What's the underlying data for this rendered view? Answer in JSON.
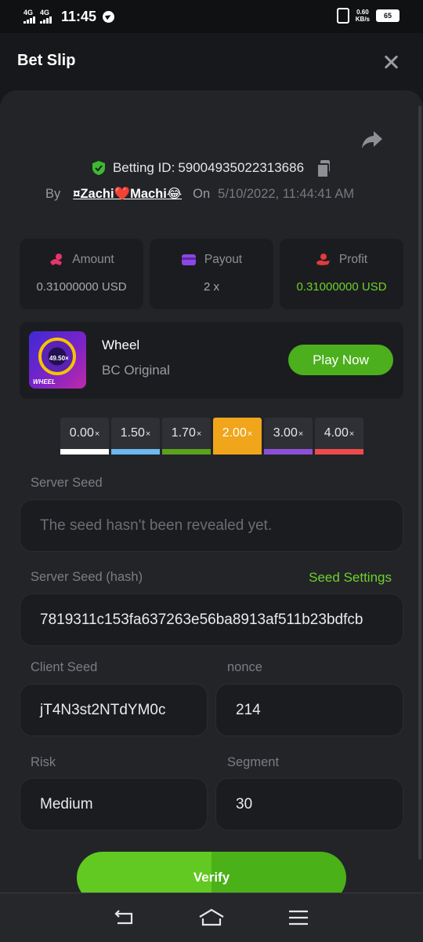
{
  "status_bar": {
    "network_1": "4G",
    "network_2": "4G",
    "time": "11:45",
    "speed": "0.60",
    "speed_unit": "KB/s",
    "battery": "65"
  },
  "header": {
    "title": "Bet Slip"
  },
  "bet_info": {
    "betting_id_label": "Betting ID:",
    "betting_id": "59004935022313686",
    "by_label": "By",
    "username": "¤Zachi❤️Machi😂",
    "on_label": "On",
    "date": "5/10/2022, 11:44:41 AM"
  },
  "stats": [
    {
      "label": "Amount",
      "value": "0.31000000 USD",
      "icon": "amount-icon"
    },
    {
      "label": "Payout",
      "value": "2 x",
      "icon": "payout-icon"
    },
    {
      "label": "Profit",
      "value": "0.31000000 USD",
      "icon": "profit-icon",
      "color": "#6ed12b"
    }
  ],
  "game": {
    "name": "Wheel",
    "subtitle": "BC Original",
    "play_label": "Play Now",
    "thumb_text": "49.50×",
    "thumb_brand": "WHEEL"
  },
  "multipliers": [
    {
      "value": "0.00",
      "suffix": "×",
      "color": "#ffffff",
      "active": false
    },
    {
      "value": "1.50",
      "suffix": "×",
      "color": "#6cb8f0",
      "active": false
    },
    {
      "value": "1.70",
      "suffix": "×",
      "color": "#5aa21c",
      "active": false
    },
    {
      "value": "2.00",
      "suffix": "×",
      "color": "#f0a51b",
      "active": true
    },
    {
      "value": "3.00",
      "suffix": "×",
      "color": "#8e4fd8",
      "active": false
    },
    {
      "value": "4.00",
      "suffix": "×",
      "color": "#ef4a4a",
      "active": false
    }
  ],
  "seeds": {
    "server_seed_label": "Server Seed",
    "server_seed_placeholder": "The seed hasn't been revealed yet.",
    "server_hash_label": "Server Seed (hash)",
    "seed_settings_label": "Seed Settings",
    "server_hash": "7819311c153fa637263e56ba8913af511b23bdfcb",
    "client_seed_label": "Client Seed",
    "client_seed": "jT4N3st2NTdYM0c",
    "nonce_label": "nonce",
    "nonce": "214",
    "risk_label": "Risk",
    "risk": "Medium",
    "segment_label": "Segment",
    "segment": "30"
  },
  "verify_label": "Verify",
  "colors": {
    "accent_green": "#6ed12b",
    "button_green": "#4caf1d",
    "active_multiplier": "#f0a51b"
  }
}
